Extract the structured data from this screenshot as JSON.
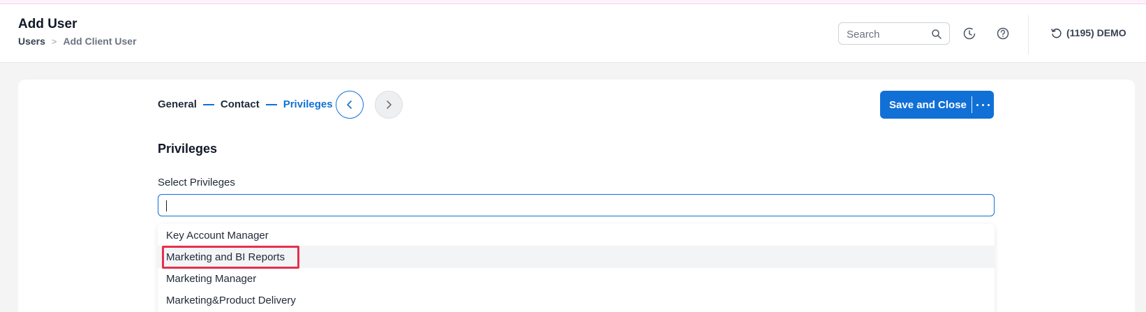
{
  "header": {
    "title": "Add User",
    "breadcrumb": {
      "root": "Users",
      "separator": ">",
      "current": "Add Client User"
    },
    "search": {
      "placeholder": "Search",
      "value": ""
    },
    "account": {
      "label": "(1195) DEMO"
    },
    "icons": [
      "search-icon",
      "history-icon",
      "help-icon",
      "switch-account-icon"
    ]
  },
  "wizard": {
    "steps": [
      {
        "label": "General",
        "active": false
      },
      {
        "label": "Contact",
        "active": false
      },
      {
        "label": "Privileges",
        "active": true
      }
    ],
    "save_label": "Save and Close"
  },
  "privileges": {
    "section_title": "Privileges",
    "field_label": "Select Privileges",
    "input_value": "",
    "options": [
      "Key Account Manager",
      "Marketing and BI Reports",
      "Marketing Manager",
      "Marketing&Product Delivery"
    ],
    "hovered_index": 1
  },
  "colors": {
    "primary": "#1170d6",
    "highlight": "#e5304d",
    "background": "#f4f4f5"
  }
}
